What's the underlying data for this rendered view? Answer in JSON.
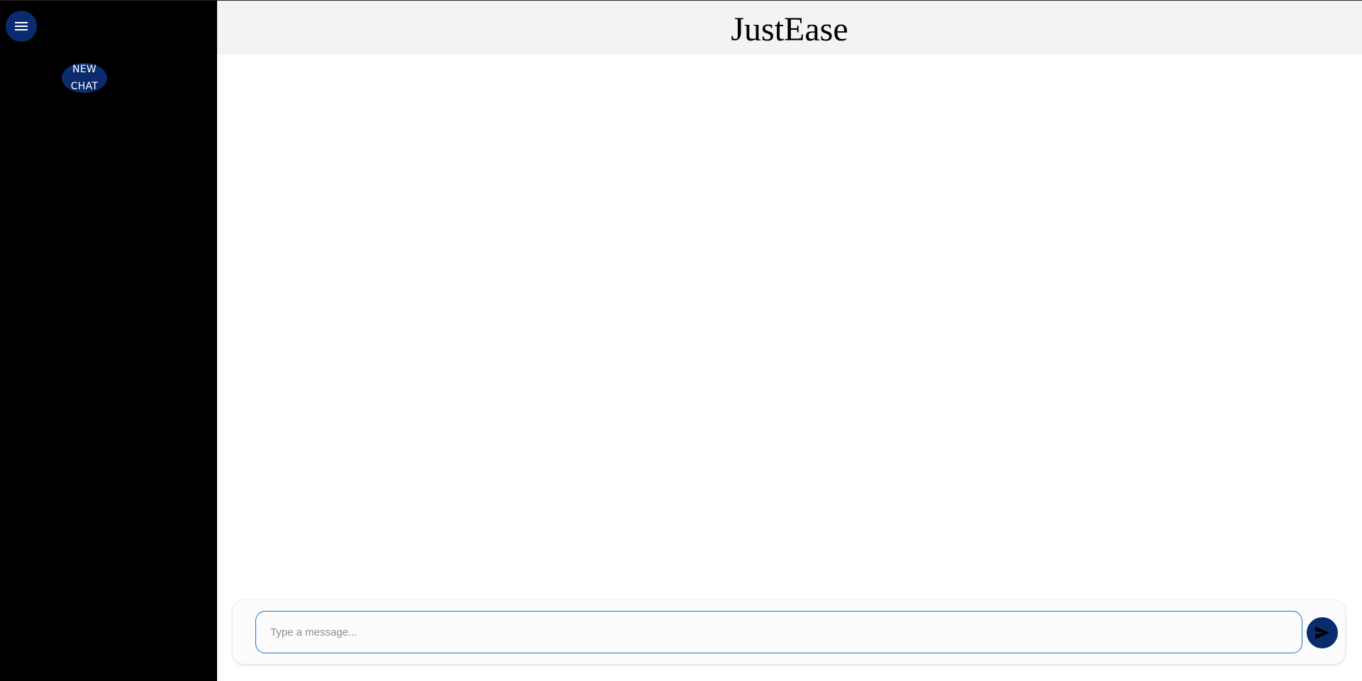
{
  "app": {
    "title": "JustEase"
  },
  "sidebar": {
    "menu_icon": "hamburger-menu-icon",
    "new_chat_label": "NEW\nCHAT"
  },
  "composer": {
    "placeholder": "Type a message...",
    "value": "",
    "send_icon": "send-icon"
  },
  "colors": {
    "sidebar_bg": "#000000",
    "accent": "#0a2c6e",
    "header_bg": "#f2f3f5",
    "input_border": "#1976d2"
  }
}
